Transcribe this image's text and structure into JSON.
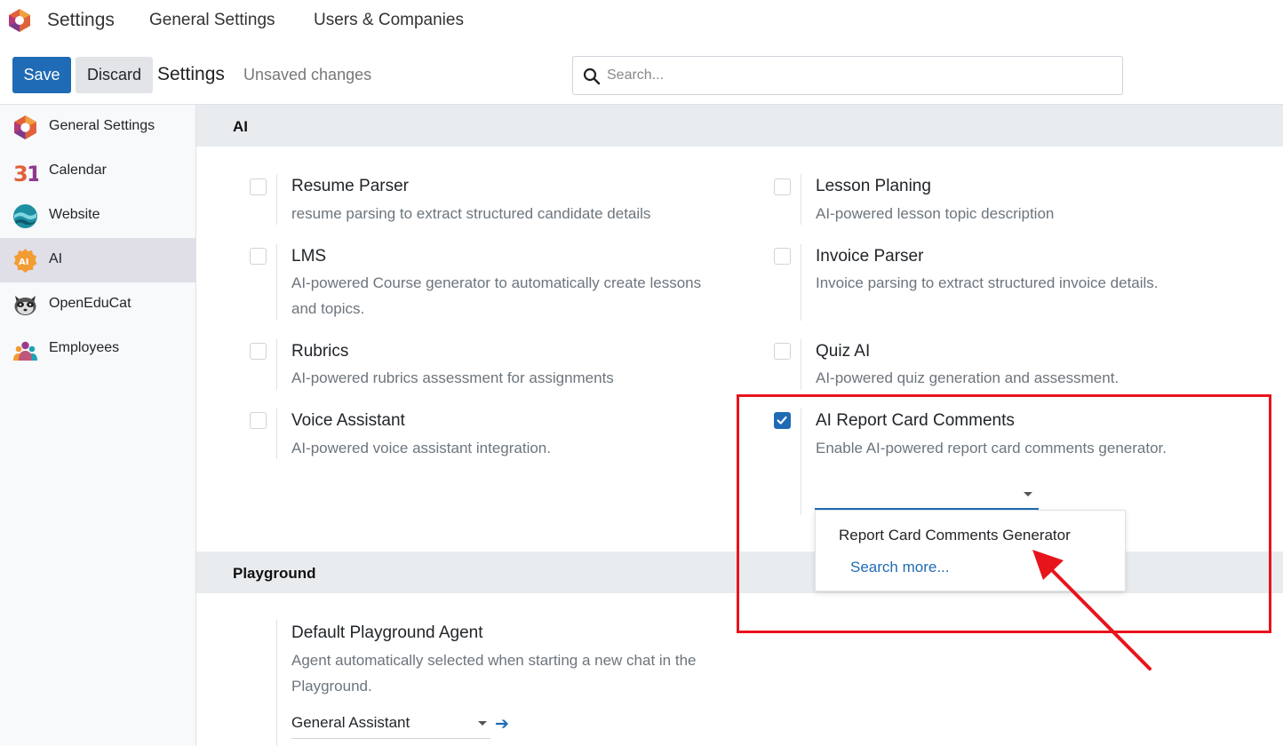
{
  "topbar": {
    "app_name": "Settings",
    "nav": [
      "General Settings",
      "Users & Companies"
    ]
  },
  "controlbar": {
    "save_label": "Save",
    "discard_label": "Discard",
    "title": "Settings",
    "status": "Unsaved changes",
    "search_placeholder": "Search..."
  },
  "sidebar": {
    "items": [
      {
        "label": "General Settings",
        "icon": "odoo-logo-icon"
      },
      {
        "label": "Calendar",
        "icon": "calendar-31-icon"
      },
      {
        "label": "Website",
        "icon": "website-icon"
      },
      {
        "label": "AI",
        "icon": "ai-badge-icon",
        "active": true
      },
      {
        "label": "OpenEduCat",
        "icon": "raccoon-icon"
      },
      {
        "label": "Employees",
        "icon": "employees-icon"
      }
    ]
  },
  "sections": {
    "ai": {
      "title": "AI",
      "settings": [
        {
          "title": "Resume Parser",
          "desc": "resume parsing to extract structured candidate details",
          "checked": false
        },
        {
          "title": "Lesson Planing",
          "desc": "AI-powered lesson topic description",
          "checked": false
        },
        {
          "title": "LMS",
          "desc": "AI-powered Course generator to automatically create lessons and topics.",
          "checked": false
        },
        {
          "title": "Invoice Parser",
          "desc": "Invoice parsing to extract structured invoice details.",
          "checked": false
        },
        {
          "title": "Rubrics",
          "desc": "AI-powered rubrics assessment for assignments",
          "checked": false
        },
        {
          "title": "Quiz AI",
          "desc": "AI-powered quiz generation and assessment.",
          "checked": false
        },
        {
          "title": "Voice Assistant",
          "desc": "AI-powered voice assistant integration.",
          "checked": false
        },
        {
          "title": "AI Report Card Comments",
          "desc": "Enable AI-powered report card comments generator.",
          "checked": true
        }
      ],
      "dropdown": {
        "option": "Report Card Comments Generator",
        "search_more": "Search more..."
      }
    },
    "playground": {
      "title": "Playground",
      "setting": {
        "title": "Default Playground Agent",
        "desc": "Agent automatically selected when starting a new chat in the Playground.",
        "value": "General Assistant"
      }
    }
  },
  "colors": {
    "primary": "#1f6bb5",
    "annotation": "#e8141c",
    "active_sidebar": "#e0dfe8"
  }
}
